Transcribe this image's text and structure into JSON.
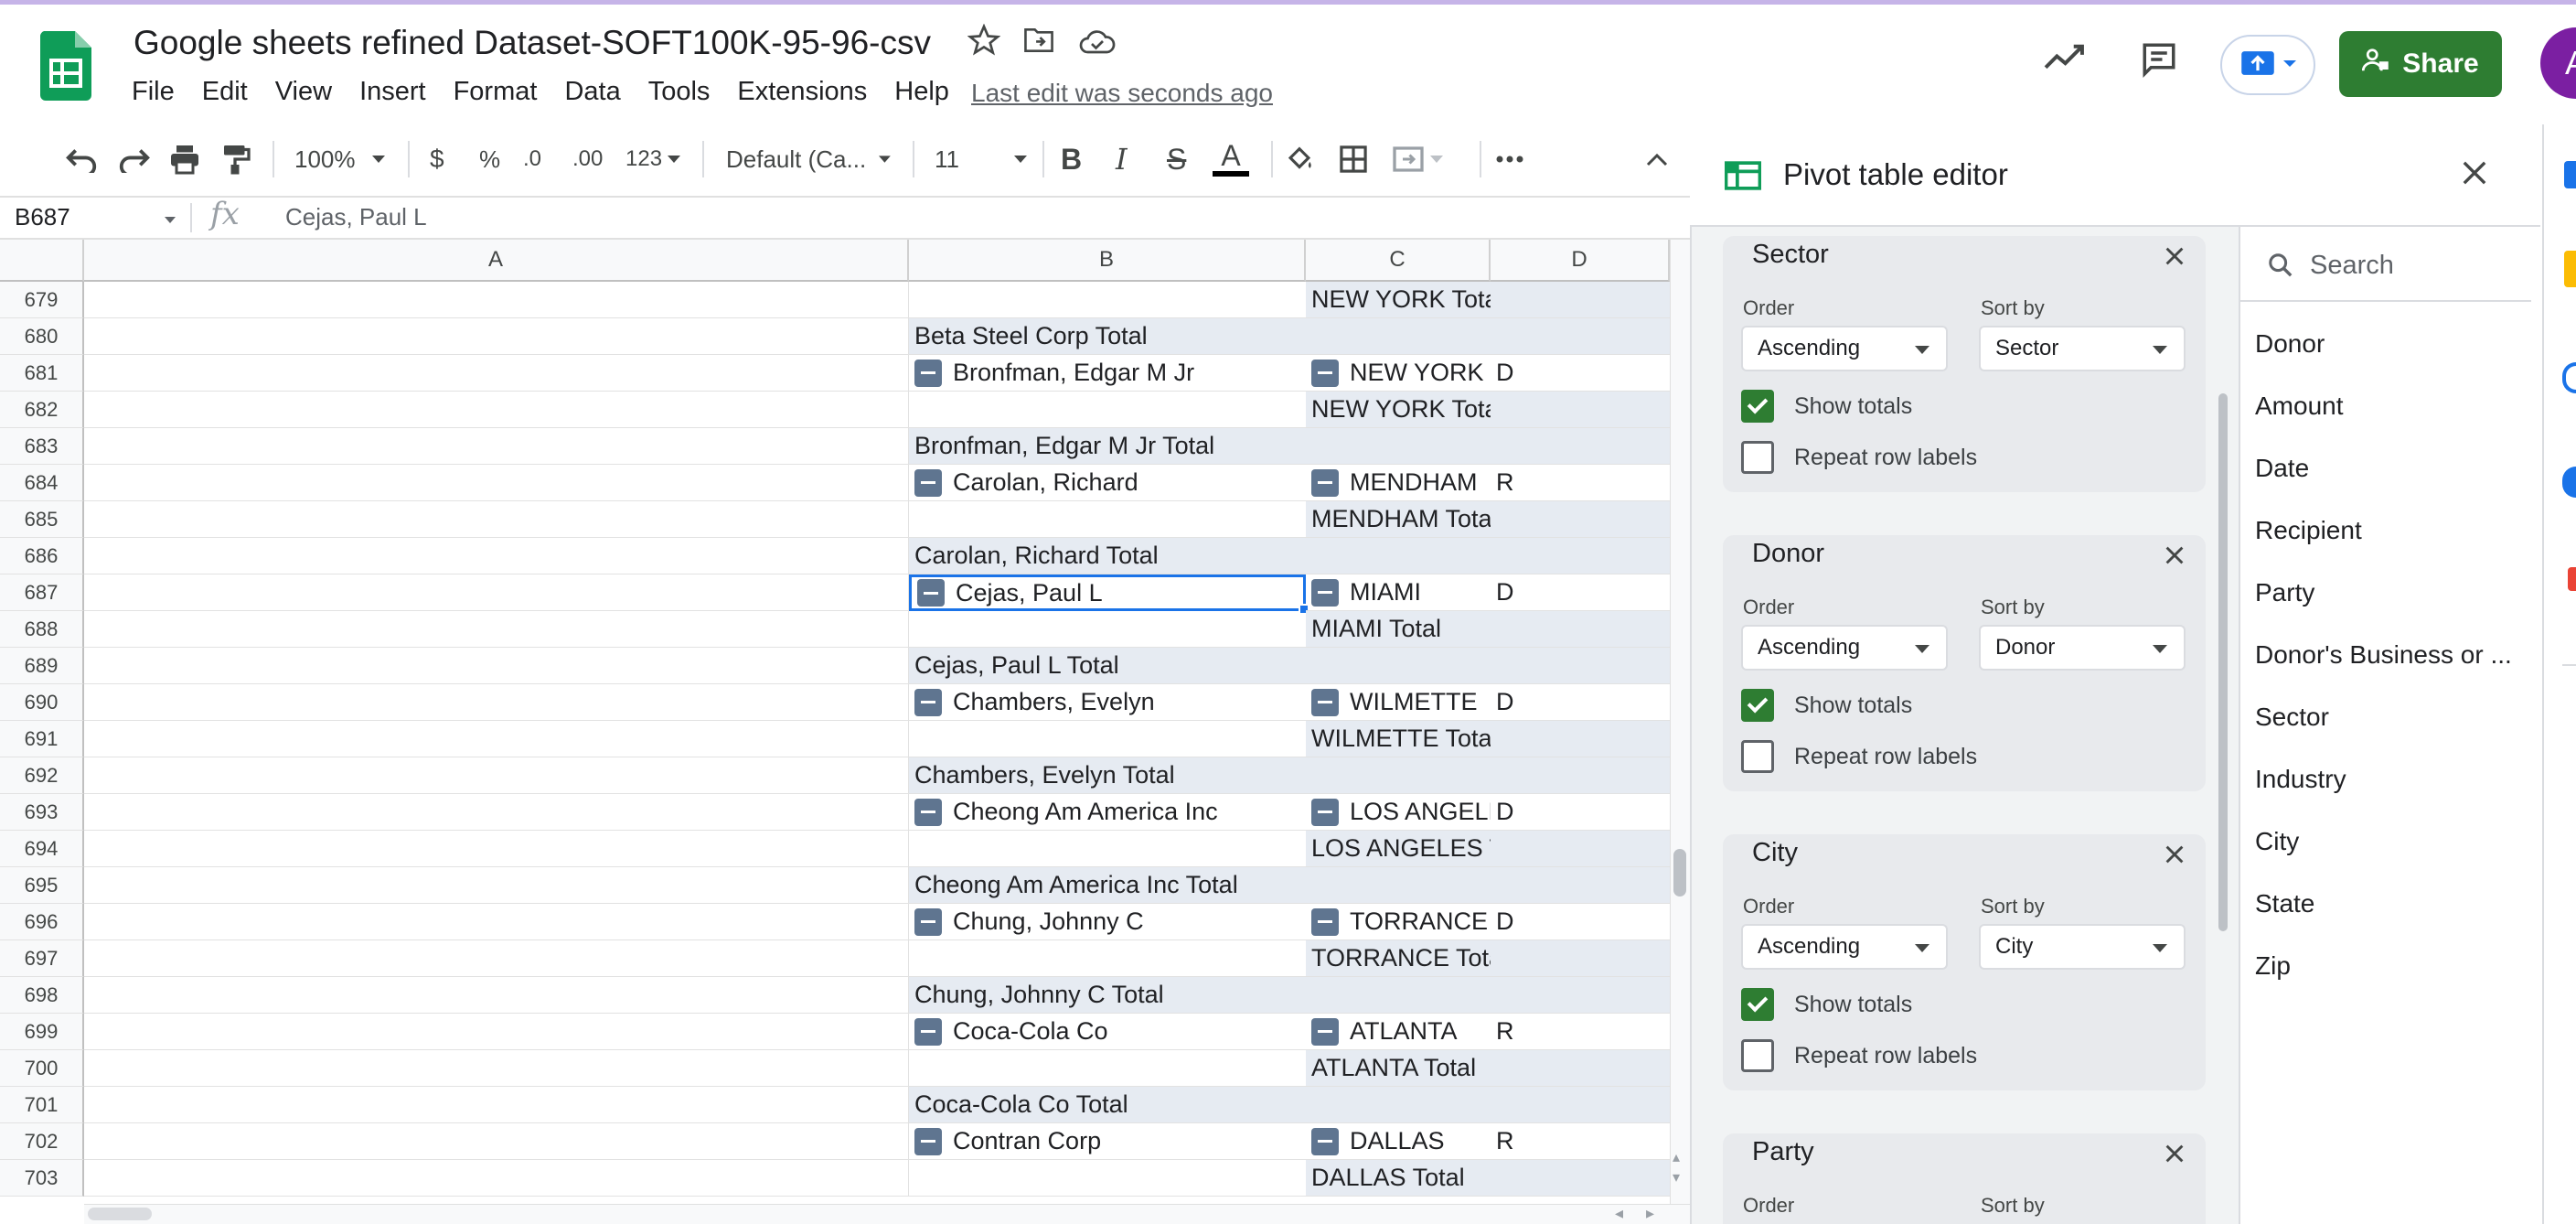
{
  "document": {
    "title": "Google sheets refined Dataset-SOFT100K-95-96-csv",
    "last_edit": "Last edit was seconds ago",
    "avatar_initial": "A"
  },
  "menu": [
    "File",
    "Edit",
    "View",
    "Insert",
    "Format",
    "Data",
    "Tools",
    "Extensions",
    "Help"
  ],
  "header_buttons": {
    "share_label": "Share"
  },
  "toolbar": {
    "zoom": "100%",
    "currency": "$",
    "percent": "%",
    "decrease_decimal": ".0",
    "increase_decimal": ".00",
    "number_format": "123",
    "font": "Default (Ca...",
    "font_size": "11",
    "bold": "B",
    "italic": "I",
    "strikethrough": "S",
    "text_color": "A"
  },
  "formula_bar": {
    "name_box": "B687",
    "fx": "fx",
    "content": "Cejas, Paul L"
  },
  "grid": {
    "columns": [
      "A",
      "B",
      "C",
      "D"
    ],
    "rows": [
      {
        "num": "679",
        "b": "",
        "c": "NEW YORK Total",
        "d": "",
        "b_btn": false,
        "c_btn": false,
        "b_shade": false,
        "c_shade": true
      },
      {
        "num": "680",
        "b": "Beta Steel Corp Total",
        "c": "",
        "d": "",
        "b_btn": false,
        "c_btn": false,
        "b_shade": true,
        "c_shade": true
      },
      {
        "num": "681",
        "b": "Bronfman, Edgar M Jr",
        "c": "NEW YORK",
        "d": "D",
        "b_btn": true,
        "c_btn": true,
        "b_shade": false,
        "c_shade": false
      },
      {
        "num": "682",
        "b": "",
        "c": "NEW YORK Total",
        "d": "",
        "b_btn": false,
        "c_btn": false,
        "b_shade": false,
        "c_shade": true
      },
      {
        "num": "683",
        "b": "Bronfman, Edgar M Jr Total",
        "c": "",
        "d": "",
        "b_btn": false,
        "c_btn": false,
        "b_shade": true,
        "c_shade": true
      },
      {
        "num": "684",
        "b": "Carolan, Richard",
        "c": "MENDHAM",
        "d": "R",
        "b_btn": true,
        "c_btn": true,
        "b_shade": false,
        "c_shade": false
      },
      {
        "num": "685",
        "b": "",
        "c": "MENDHAM Total",
        "d": "",
        "b_btn": false,
        "c_btn": false,
        "b_shade": false,
        "c_shade": true
      },
      {
        "num": "686",
        "b": "Carolan, Richard Total",
        "c": "",
        "d": "",
        "b_btn": false,
        "c_btn": false,
        "b_shade": true,
        "c_shade": true
      },
      {
        "num": "687",
        "b": "Cejas, Paul L",
        "c": "MIAMI",
        "d": "D",
        "b_btn": true,
        "c_btn": true,
        "b_shade": false,
        "c_shade": false
      },
      {
        "num": "688",
        "b": "",
        "c": "MIAMI Total",
        "d": "",
        "b_btn": false,
        "c_btn": false,
        "b_shade": false,
        "c_shade": true
      },
      {
        "num": "689",
        "b": "Cejas, Paul L Total",
        "c": "",
        "d": "",
        "b_btn": false,
        "c_btn": false,
        "b_shade": true,
        "c_shade": true
      },
      {
        "num": "690",
        "b": "Chambers, Evelyn",
        "c": "WILMETTE",
        "d": "D",
        "b_btn": true,
        "c_btn": true,
        "b_shade": false,
        "c_shade": false
      },
      {
        "num": "691",
        "b": "",
        "c": "WILMETTE Total",
        "d": "",
        "b_btn": false,
        "c_btn": false,
        "b_shade": false,
        "c_shade": true
      },
      {
        "num": "692",
        "b": "Chambers, Evelyn Total",
        "c": "",
        "d": "",
        "b_btn": false,
        "c_btn": false,
        "b_shade": true,
        "c_shade": true
      },
      {
        "num": "693",
        "b": "Cheong Am America Inc",
        "c": "LOS ANGELES",
        "d": "D",
        "b_btn": true,
        "c_btn": true,
        "b_shade": false,
        "c_shade": false
      },
      {
        "num": "694",
        "b": "",
        "c": "LOS ANGELES Total",
        "d": "",
        "b_btn": false,
        "c_btn": false,
        "b_shade": false,
        "c_shade": true
      },
      {
        "num": "695",
        "b": "Cheong Am America Inc Total",
        "c": "",
        "d": "",
        "b_btn": false,
        "c_btn": false,
        "b_shade": true,
        "c_shade": true
      },
      {
        "num": "696",
        "b": "Chung, Johnny C",
        "c": "TORRANCE",
        "d": "D",
        "b_btn": true,
        "c_btn": true,
        "b_shade": false,
        "c_shade": false
      },
      {
        "num": "697",
        "b": "",
        "c": "TORRANCE Total",
        "d": "",
        "b_btn": false,
        "c_btn": false,
        "b_shade": false,
        "c_shade": true
      },
      {
        "num": "698",
        "b": "Chung, Johnny C Total",
        "c": "",
        "d": "",
        "b_btn": false,
        "c_btn": false,
        "b_shade": true,
        "c_shade": true
      },
      {
        "num": "699",
        "b": "Coca-Cola Co",
        "c": "ATLANTA",
        "d": "R",
        "b_btn": true,
        "c_btn": true,
        "b_shade": false,
        "c_shade": false
      },
      {
        "num": "700",
        "b": "",
        "c": "ATLANTA Total",
        "d": "",
        "b_btn": false,
        "c_btn": false,
        "b_shade": false,
        "c_shade": true
      },
      {
        "num": "701",
        "b": "Coca-Cola Co Total",
        "c": "",
        "d": "",
        "b_btn": false,
        "c_btn": false,
        "b_shade": true,
        "c_shade": true
      },
      {
        "num": "702",
        "b": "Contran Corp",
        "c": "DALLAS",
        "d": "R",
        "b_btn": true,
        "c_btn": true,
        "b_shade": false,
        "c_shade": false
      },
      {
        "num": "703",
        "b": "",
        "c": "DALLAS Total",
        "d": "",
        "b_btn": false,
        "c_btn": false,
        "b_shade": false,
        "c_shade": true
      }
    ]
  },
  "pivot_editor": {
    "title": "Pivot table editor",
    "order_label": "Order",
    "sort_by_label": "Sort by",
    "show_totals_label": "Show totals",
    "repeat_labels_label": "Repeat row labels",
    "cards": [
      {
        "name": "Sector",
        "order": "Ascending",
        "sort_by": "Sector",
        "show_totals": true,
        "repeat": false
      },
      {
        "name": "Donor",
        "order": "Ascending",
        "sort_by": "Donor",
        "show_totals": true,
        "repeat": false
      },
      {
        "name": "City",
        "order": "Ascending",
        "sort_by": "City",
        "show_totals": true,
        "repeat": false
      },
      {
        "name": "Party",
        "order": "",
        "sort_by": "",
        "show_totals": false,
        "repeat": false
      }
    ]
  },
  "fields": {
    "search_placeholder": "Search",
    "items": [
      "Donor",
      "Amount",
      "Date",
      "Recipient",
      "Party",
      "Donor's Business or ...",
      "Sector",
      "Industry",
      "City",
      "State",
      "Zip"
    ]
  },
  "colors": {
    "share_green": "#2e7d32",
    "selection_blue": "#1a73e8",
    "pivot_shade": "#e6ebf2",
    "checkbox_green": "#2e7d32"
  }
}
